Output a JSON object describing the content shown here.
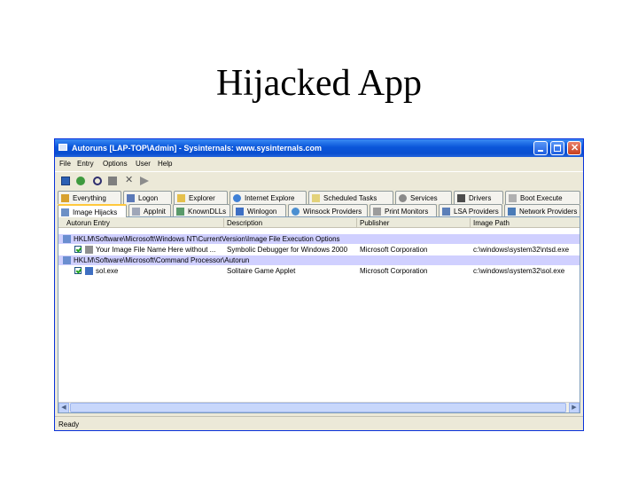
{
  "slide": {
    "title": "Hijacked App"
  },
  "window": {
    "title": "Autoruns [LAP-TOP\\Admin] - Sysinternals: www.sysinternals.com"
  },
  "menu": [
    "File",
    "Entry",
    "Options",
    "User",
    "Help"
  ],
  "toolbar": {
    "icons": [
      "save-icon",
      "refresh-icon",
      "find-icon",
      "copy-icon",
      "delete-icon",
      "jump-icon"
    ]
  },
  "tabs_row1": [
    "Everything",
    "Logon",
    "Explorer",
    "Internet Explore",
    "Scheduled Tasks",
    "Services",
    "Drivers",
    "Boot Execute"
  ],
  "tabs_row2": [
    "Image Hijacks",
    "AppInit",
    "KnownDLLs",
    "Winlogon",
    "Winsock Providers",
    "Print Monitors",
    "LSA Providers",
    "Network Providers"
  ],
  "table": {
    "columns": [
      "Autorun Entry",
      "Description",
      "Publisher",
      "Image Path"
    ],
    "rows": [
      {
        "type": "group",
        "entry": "HKLM\\Software\\Microsoft\\Windows NT\\CurrentVersion\\Image File Execution Options"
      },
      {
        "type": "item",
        "entry": "Your Image File Name Here without ...",
        "description": "Symbolic Debugger for Windows 2000",
        "publisher": "Microsoft Corporation",
        "path": "c:\\windows\\system32\\ntsd.exe"
      },
      {
        "type": "group",
        "entry": "HKLM\\Software\\Microsoft\\Command Processor\\Autorun"
      },
      {
        "type": "item",
        "entry": "sol.exe",
        "description": "Solitaire Game Applet",
        "publisher": "Microsoft Corporation",
        "path": "c:\\windows\\system32\\sol.exe"
      }
    ]
  },
  "status": "Ready",
  "colors": {
    "group_row": "#d0d0ff",
    "titlebar": "#0a55d9",
    "active_tab_accent": "#ffc83c"
  }
}
